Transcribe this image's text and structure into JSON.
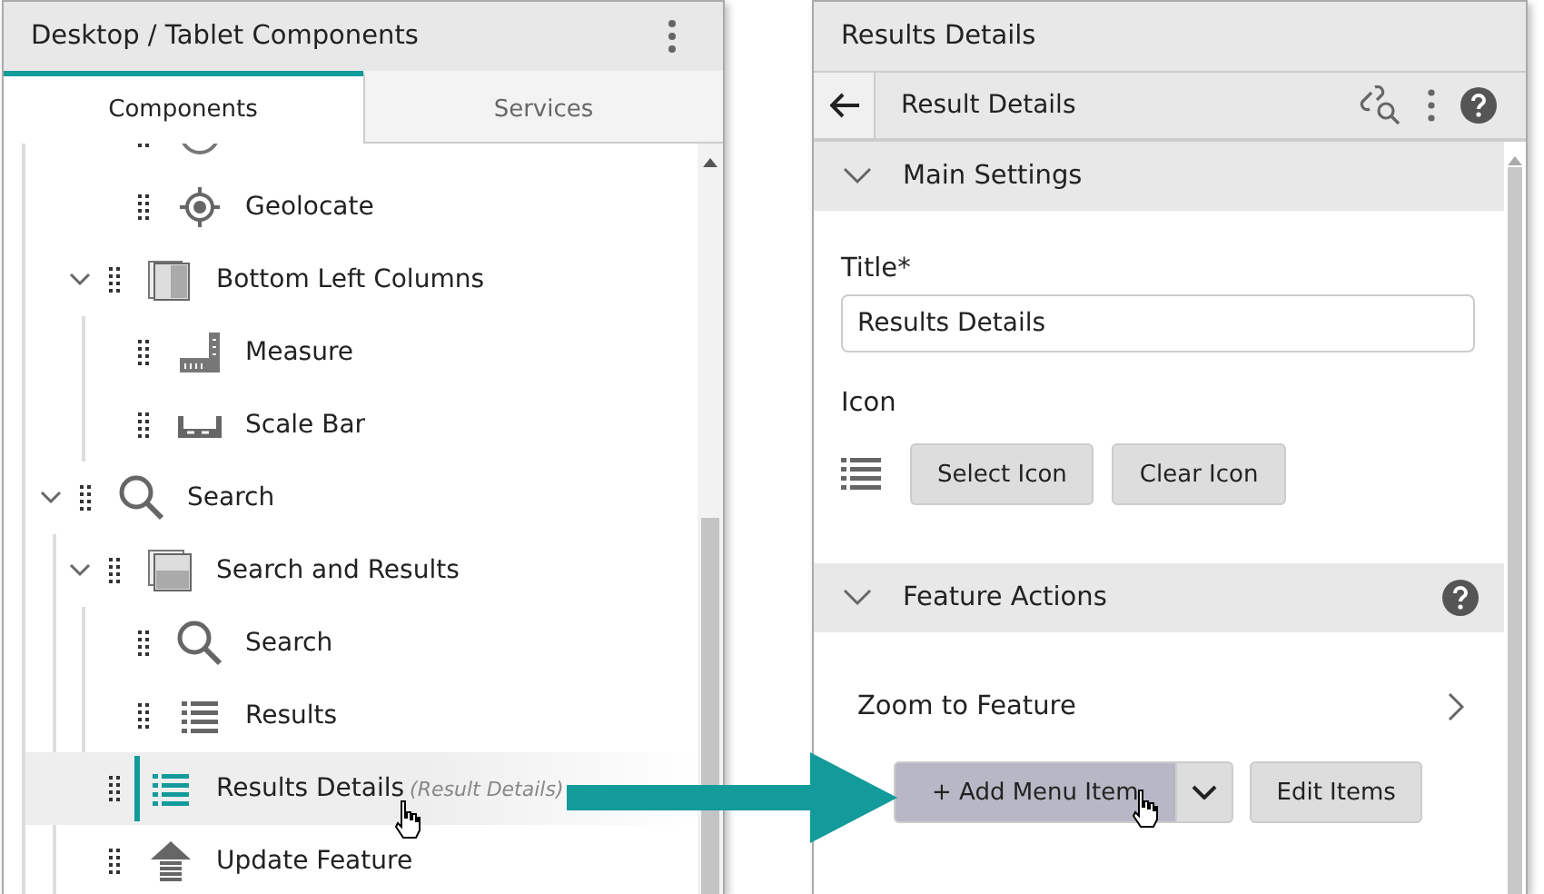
{
  "left_panel": {
    "title": "Desktop / Tablet Components",
    "tabs": [
      {
        "label": "Components",
        "selected": true
      },
      {
        "label": "Services",
        "selected": false
      }
    ],
    "tree": [
      {
        "children": [
          {
            "children": [
              {
                "kind": "compass",
                "selected": false
              },
              {
                "label": "Geolocate",
                "kind": "geolocate",
                "selected": false
              }
            ]
          },
          {
            "label": "Bottom Left Columns",
            "kind": "columns",
            "expanded": true,
            "selected": false,
            "children": [
              {
                "label": "Measure",
                "kind": "measure",
                "selected": false
              },
              {
                "label": "Scale Bar",
                "kind": "scale-bar",
                "selected": false
              }
            ]
          }
        ]
      },
      {
        "label": "Search",
        "kind": "search",
        "expanded": true,
        "selected": false,
        "children": [
          {
            "label": "Search and Results",
            "kind": "panel",
            "expanded": true,
            "selected": false,
            "children": [
              {
                "label": "Search",
                "kind": "search",
                "selected": false
              },
              {
                "label": "Results",
                "kind": "list",
                "selected": false
              }
            ]
          },
          {
            "label": "Results Details",
            "note": "(Result Details)",
            "kind": "list",
            "selected": true
          },
          {
            "label": "Update Feature",
            "kind": "upload",
            "selected": false
          }
        ]
      }
    ]
  },
  "right_panel": {
    "title": "Results Details",
    "toolbar_title": "Result Details",
    "sections": [
      {
        "title": "Main Settings",
        "expanded": true,
        "help": false,
        "kind": "settings",
        "title_label": "Title*",
        "title_value": "Results Details",
        "icon_label": "Icon",
        "buttons": [
          "Select Icon",
          "Clear Icon"
        ]
      },
      {
        "title": "Feature Actions",
        "expanded": true,
        "help": true,
        "kind": "actions",
        "items": [
          "Zoom to Feature"
        ],
        "add_button": "+ Add Menu Item",
        "edit_button": "Edit Items"
      }
    ]
  }
}
